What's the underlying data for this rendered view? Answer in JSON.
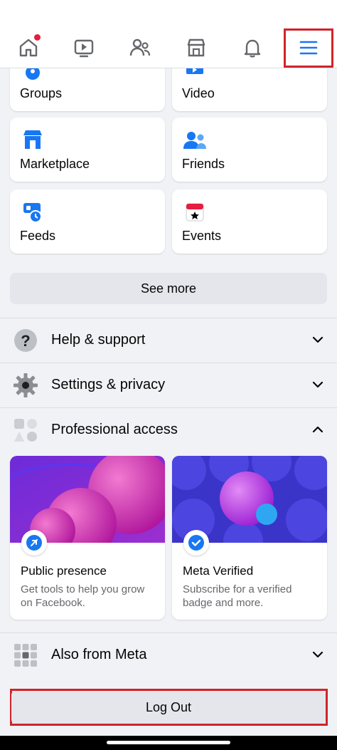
{
  "nav": {
    "items": [
      {
        "icon": "home-icon",
        "has_notification": true
      },
      {
        "icon": "video-icon"
      },
      {
        "icon": "friends-icon"
      },
      {
        "icon": "marketplace-icon"
      },
      {
        "icon": "notifications-bell-icon"
      },
      {
        "icon": "menu-icon",
        "active": true
      }
    ],
    "accent": "#1877f2"
  },
  "shortcuts": [
    {
      "label": "Groups",
      "icon": "groups-icon"
    },
    {
      "label": "Video",
      "icon": "video-icon"
    },
    {
      "label": "Marketplace",
      "icon": "marketplace-icon"
    },
    {
      "label": "Friends",
      "icon": "friends-icon"
    },
    {
      "label": "Feeds",
      "icon": "feeds-icon"
    },
    {
      "label": "Events",
      "icon": "events-icon"
    }
  ],
  "see_more_label": "See more",
  "sections": {
    "help": {
      "label": "Help & support",
      "icon": "question-icon",
      "expanded": false
    },
    "settings": {
      "label": "Settings & privacy",
      "icon": "gear-icon",
      "expanded": false
    },
    "professional": {
      "label": "Professional access",
      "icon": "professional-icon",
      "expanded": true
    },
    "meta": {
      "label": "Also from Meta",
      "icon": "grid-icon",
      "expanded": false
    }
  },
  "pro_cards": [
    {
      "title": "Public presence",
      "desc": "Get tools to help you grow on Facebook.",
      "icon": "rocket-icon"
    },
    {
      "title": "Meta Verified",
      "desc": "Subscribe for a verified badge and more.",
      "icon": "verified-badge-icon"
    }
  ],
  "logout_label": "Log Out"
}
